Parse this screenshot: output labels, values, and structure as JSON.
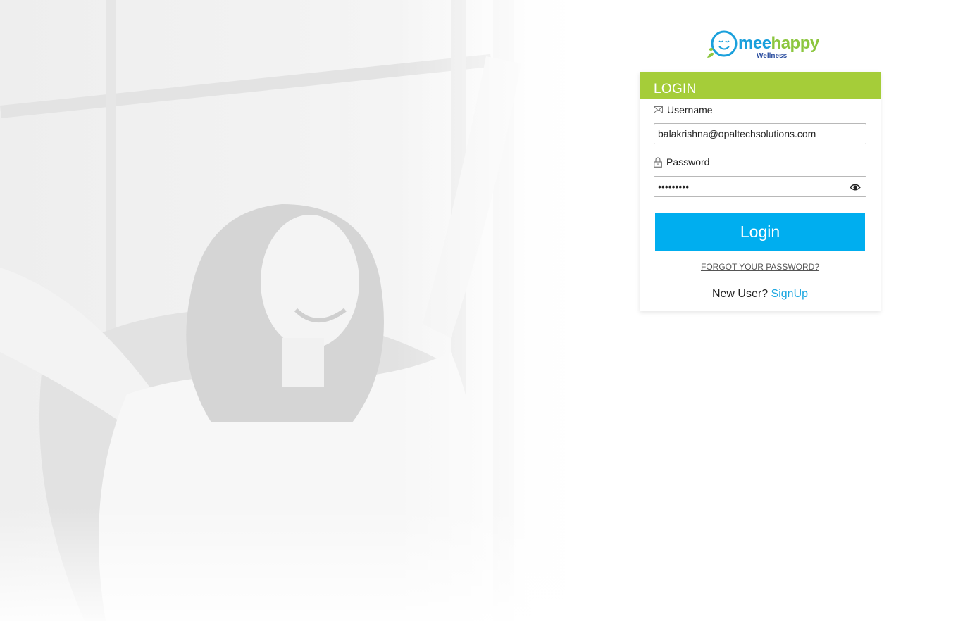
{
  "brand": {
    "logo_mee": "mee",
    "logo_happy": "happy",
    "logo_tagline": "Wellness"
  },
  "login": {
    "title": "LOGIN",
    "username_label": "Username",
    "username_value": "balakrishna@opaltechsolutions.com",
    "password_label": "Password",
    "password_value": "123456789",
    "login_button": "Login",
    "forgot_password": "FORGOT YOUR PASSWORD?",
    "new_user_text": "New User?",
    "signup_link": "SignUp"
  },
  "icons": {
    "username": "envelope-icon",
    "password": "lock-icon",
    "show_password": "eye-icon"
  },
  "colors": {
    "header_green": "#a5cd39",
    "button_blue": "#00aeef",
    "link_blue": "#1aa6e0"
  }
}
